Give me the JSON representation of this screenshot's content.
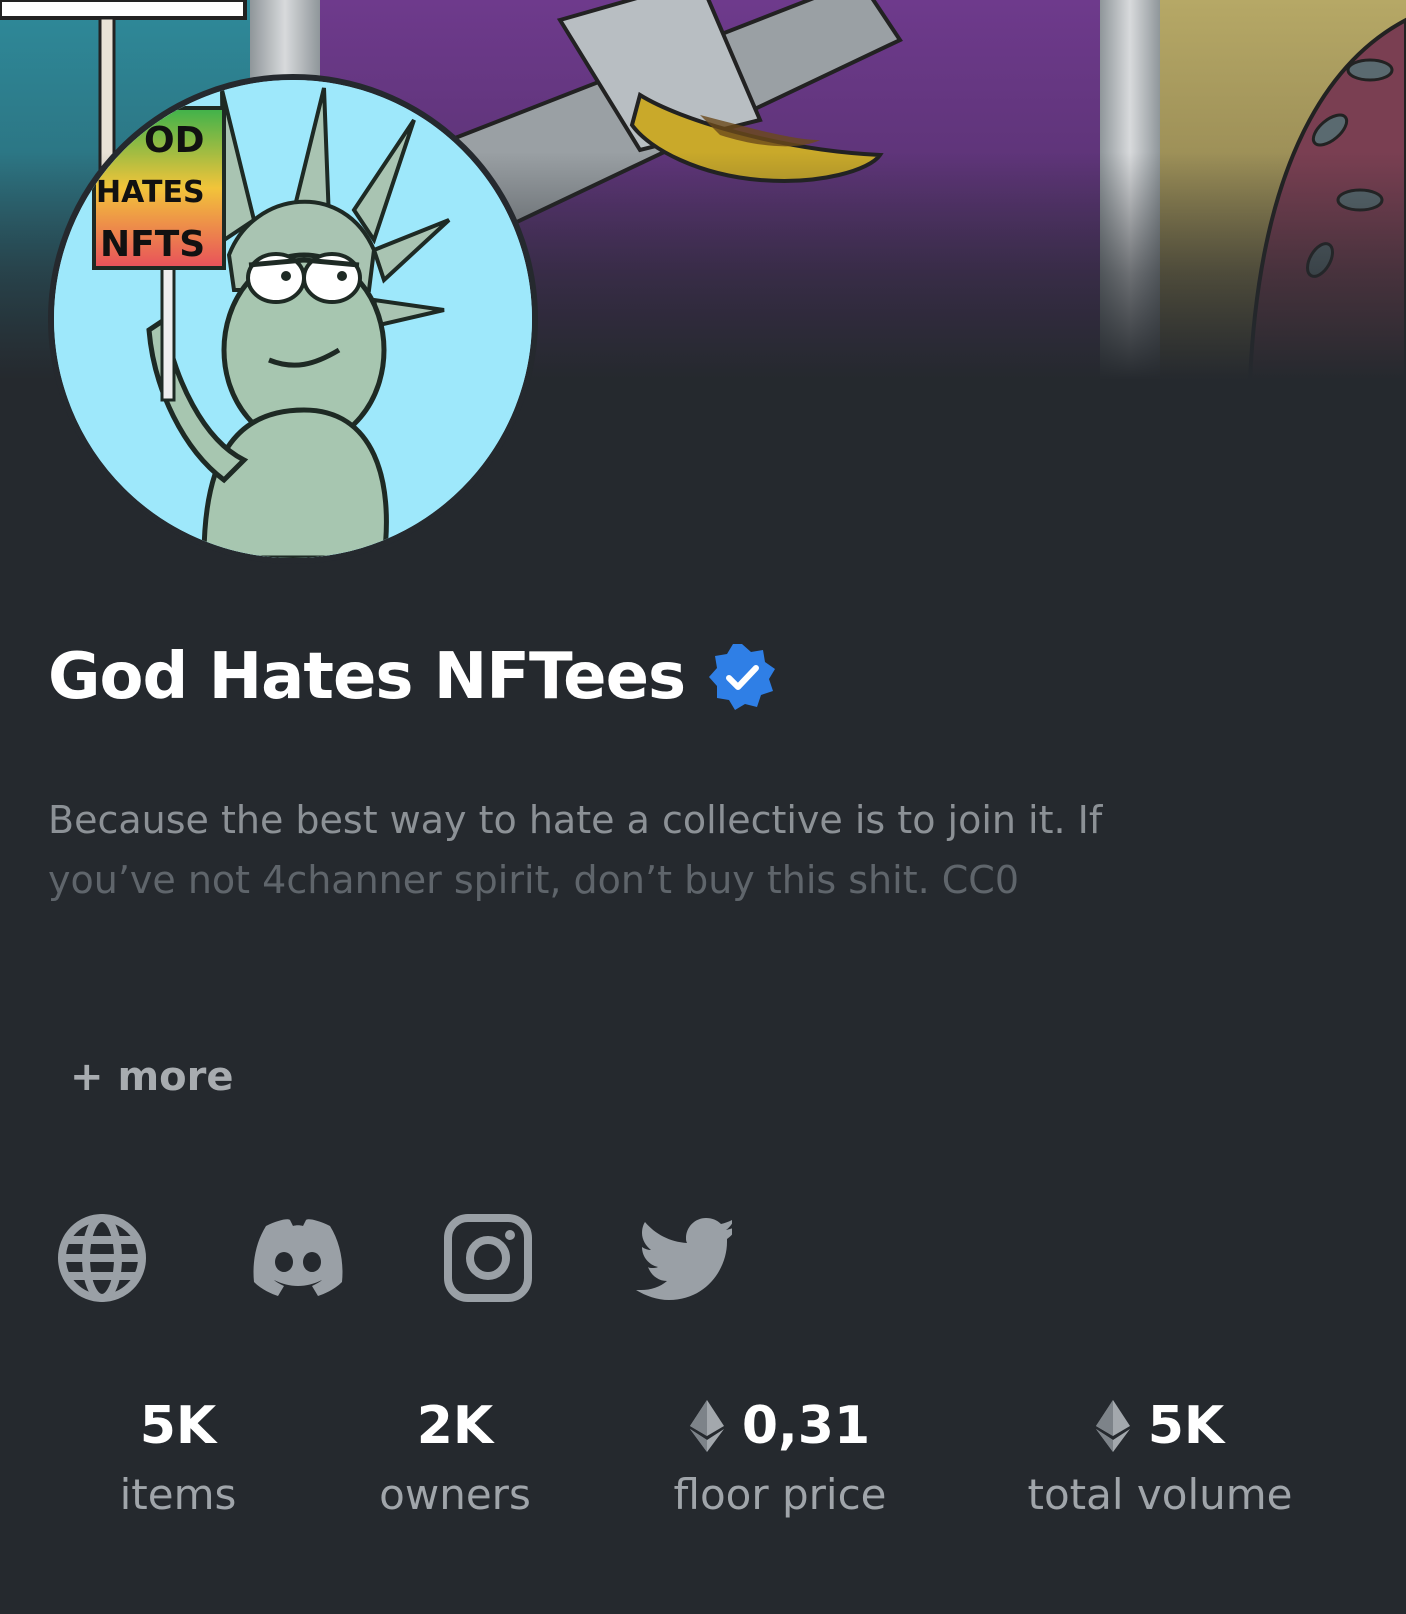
{
  "collection": {
    "name": "God Hates NFTees",
    "description_line1": "Because the best way to hate a collective is to join it. If",
    "description_line2": "you’ve not 4channer spirit, don’t buy this shit. CC0",
    "more_label": "+ more",
    "avatar_sign_text": [
      "OD",
      "HATES",
      "NFTS"
    ]
  },
  "social": [
    {
      "icon": "globe-icon"
    },
    {
      "icon": "discord-icon"
    },
    {
      "icon": "instagram-icon"
    },
    {
      "icon": "twitter-icon"
    }
  ],
  "stats": [
    {
      "value": "5K",
      "label": "items",
      "currency_icon": false
    },
    {
      "value": "2K",
      "label": "owners",
      "currency_icon": false
    },
    {
      "value": "0,31",
      "label": "floor price",
      "currency_icon": true
    },
    {
      "value": "5K",
      "label": "total volume",
      "currency_icon": true
    }
  ],
  "colors": {
    "background": "#25292e",
    "verified_badge": "#2f7fe6",
    "banner_purple": "#6a3a86",
    "banner_teal": "#2e7f8f",
    "banner_olive": "#a8995a"
  }
}
